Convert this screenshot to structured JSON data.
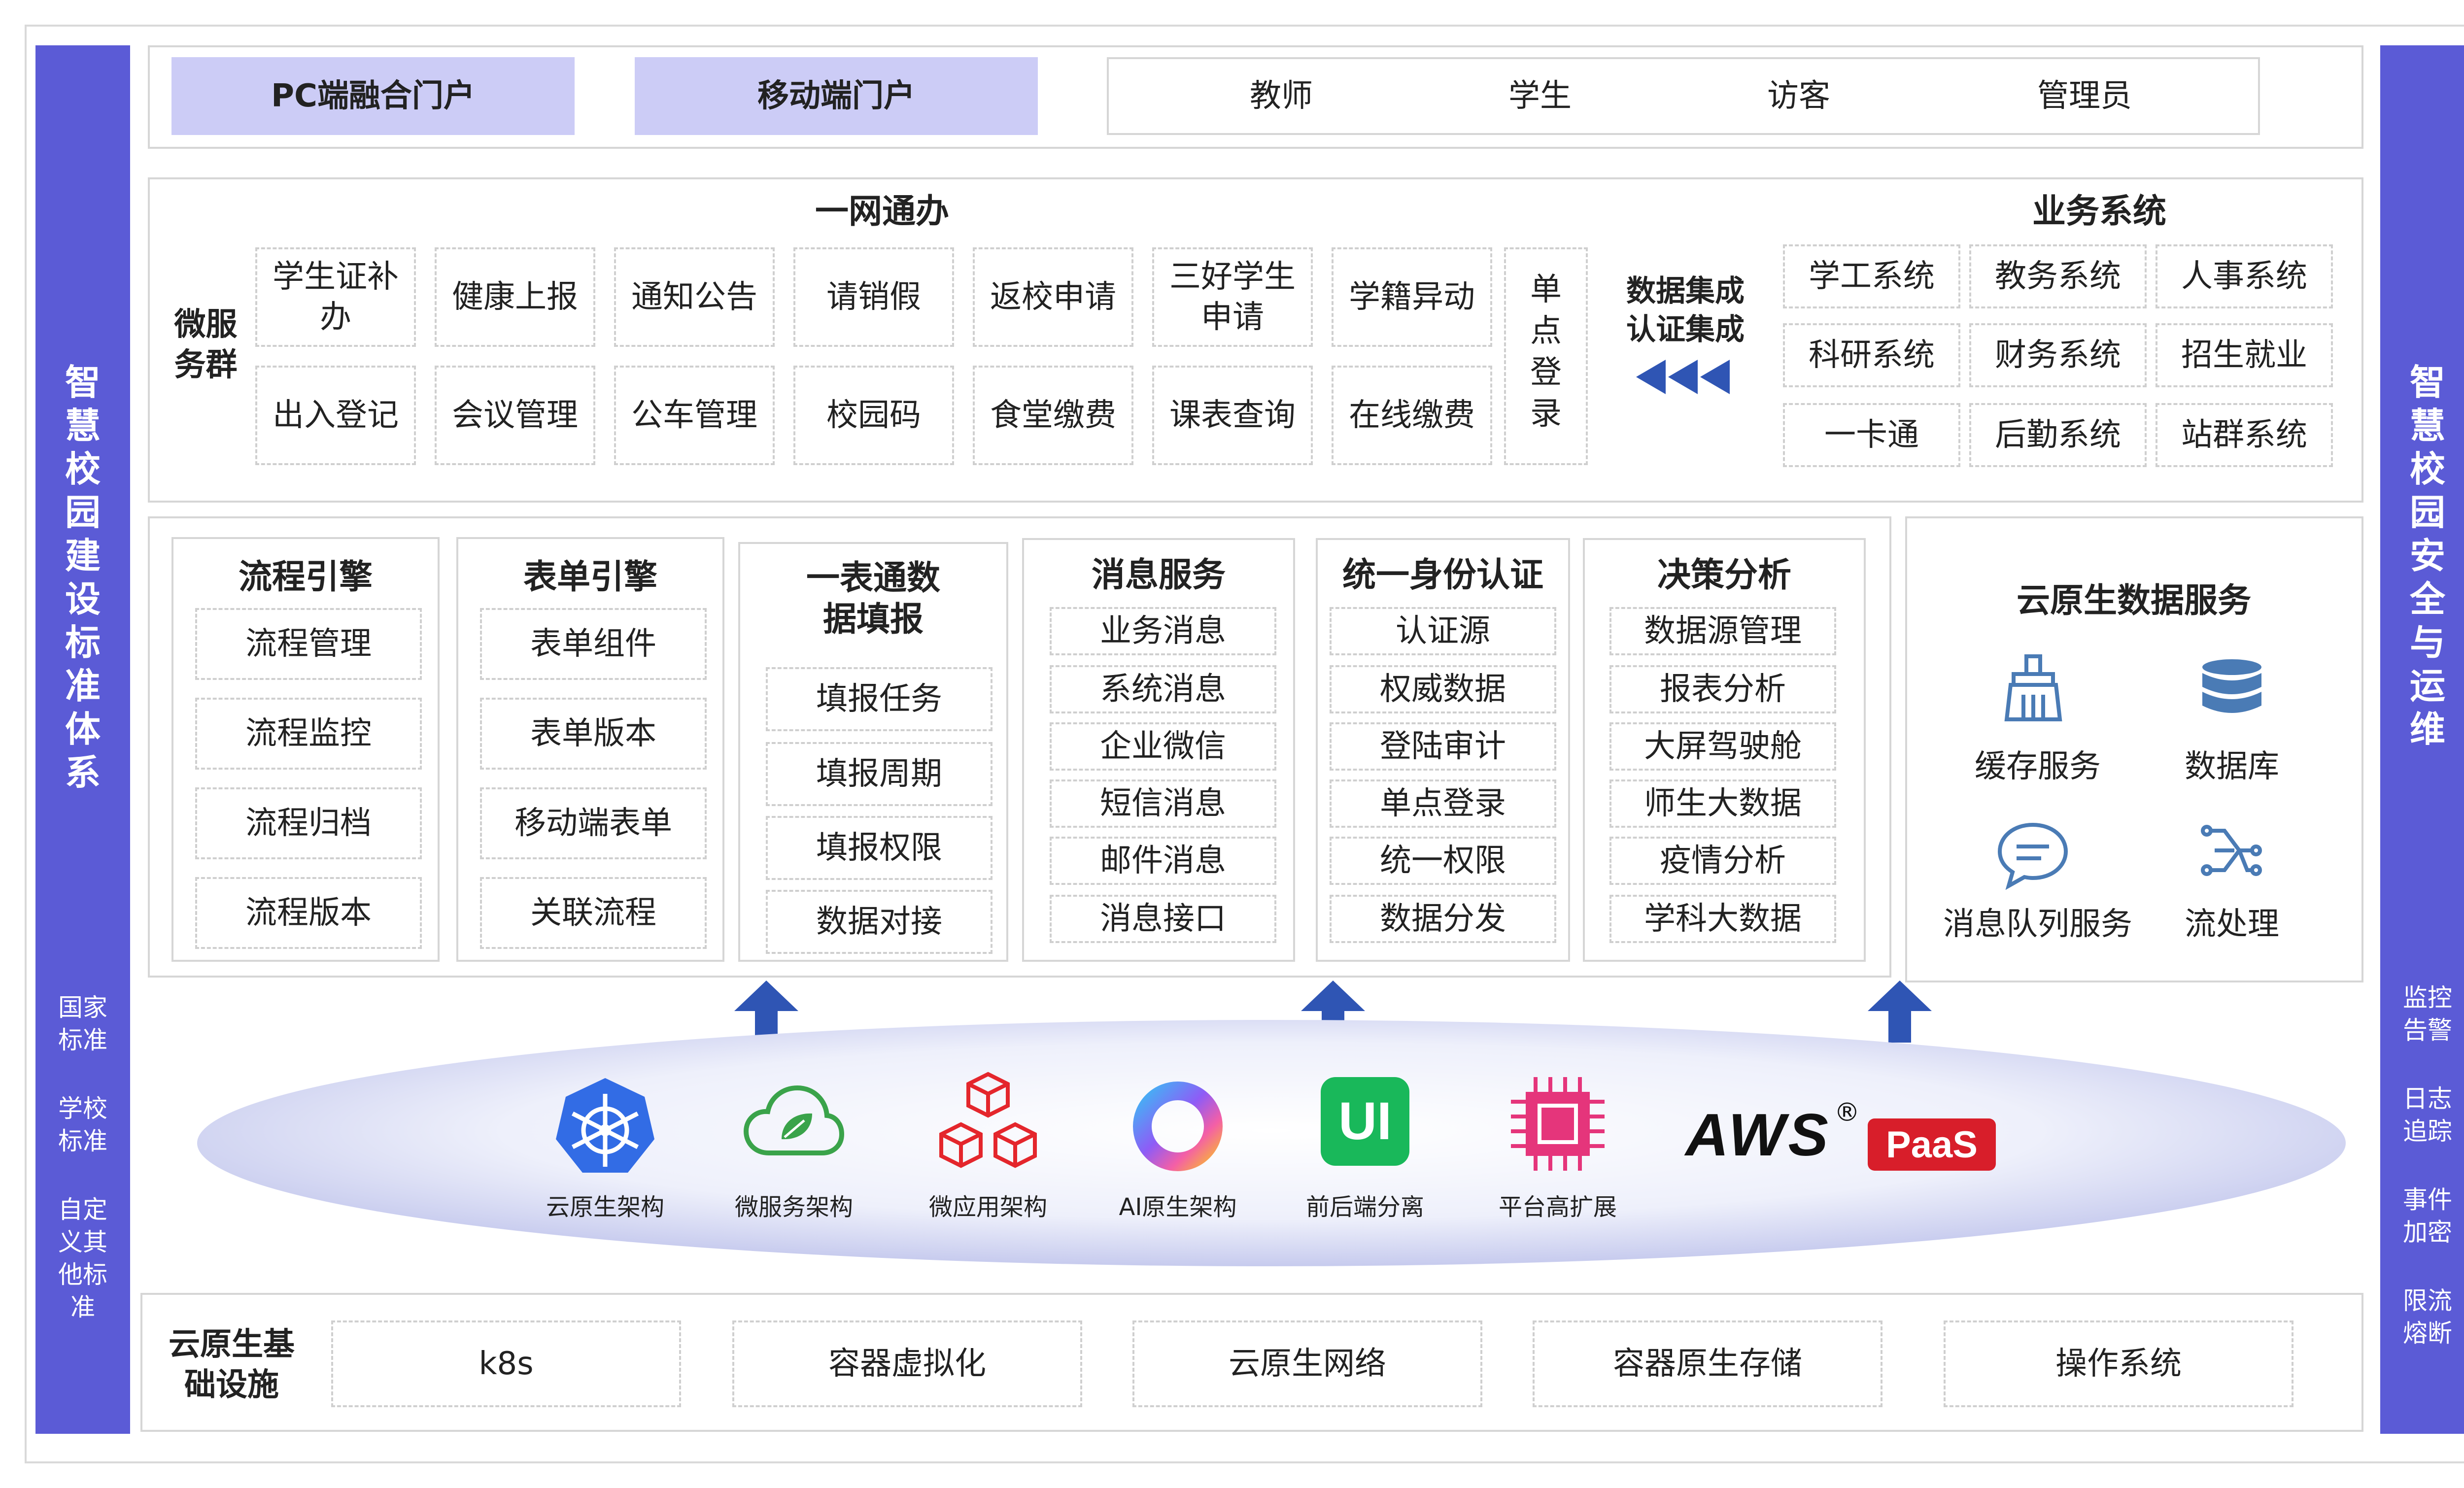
{
  "left_sidebar": {
    "title_chars": [
      "智",
      "慧",
      "校",
      "园",
      "建",
      "设",
      "标",
      "准",
      "体",
      "系"
    ],
    "items": [
      "国家标准",
      "学校标准",
      "自定义其他标准"
    ]
  },
  "right_sidebar": {
    "title_chars": [
      "智",
      "慧",
      "校",
      "园",
      "安",
      "全",
      "与",
      "运",
      "维"
    ],
    "items": [
      "监控告警",
      "日志追踪",
      "事件加密",
      "限流熔断"
    ]
  },
  "portal": {
    "pc": "PC端融合门户",
    "mobile": "移动端门户",
    "roles": [
      "教师",
      "学生",
      "访客",
      "管理员"
    ]
  },
  "services": {
    "title": "一网通办",
    "group_label": "微服务群",
    "row1": [
      "学生证补办",
      "健康上报",
      "通知公告",
      "请销假",
      "返校申请",
      "三好学生申请",
      "学籍异动"
    ],
    "row2": [
      "出入登记",
      "会议管理",
      "公车管理",
      "校园码",
      "食堂缴费",
      "课表查询",
      "在线缴费"
    ],
    "sso": [
      "单",
      "点",
      "登",
      "录"
    ],
    "integration": "数据集成认证集成",
    "biz_title": "业务系统",
    "biz": [
      "学工系统",
      "教务系统",
      "人事系统",
      "科研系统",
      "财务系统",
      "招生就业",
      "一卡通",
      "后勤系统",
      "站群系统"
    ]
  },
  "engines": [
    {
      "title": "流程引擎",
      "items": [
        "流程管理",
        "流程监控",
        "流程归档",
        "流程版本"
      ]
    },
    {
      "title": "表单引擎",
      "items": [
        "表单组件",
        "表单版本",
        "移动端表单",
        "关联流程"
      ]
    },
    {
      "title": "一表通数据填报",
      "items": [
        "填报任务",
        "填报周期",
        "填报权限",
        "数据对接"
      ]
    },
    {
      "title": "消息服务",
      "items": [
        "业务消息",
        "系统消息",
        "企业微信",
        "短信消息",
        "邮件消息",
        "消息接口"
      ]
    },
    {
      "title": "统一身份认证",
      "items": [
        "认证源",
        "权威数据",
        "登陆审计",
        "单点登录",
        "统一权限",
        "数据分发"
      ]
    },
    {
      "title": "决策分析",
      "items": [
        "数据源管理",
        "报表分析",
        "大屏驾驶舱",
        "师生大数据",
        "疫情分析",
        "学科大数据"
      ]
    }
  ],
  "cloud_data": {
    "title": "云原生数据服务",
    "items": [
      {
        "label": "缓存服务",
        "icon": "broom-icon"
      },
      {
        "label": "数据库",
        "icon": "database-icon"
      },
      {
        "label": "消息队列服务",
        "icon": "chat-bubble-icon"
      },
      {
        "label": "流处理",
        "icon": "stream-icon"
      }
    ]
  },
  "tech": [
    {
      "label": "云原生架构",
      "icon": "kubernetes-icon"
    },
    {
      "label": "微服务架构",
      "icon": "cloud-leaf-icon"
    },
    {
      "label": "微应用架构",
      "icon": "cubes-icon"
    },
    {
      "label": "AI原生架构",
      "icon": "ai-ring-icon"
    },
    {
      "label": "前后端分离",
      "icon": "ui-icon"
    },
    {
      "label": "平台高扩展",
      "icon": "chip-icon"
    }
  ],
  "aws": {
    "text": "AWS",
    "reg": "®",
    "paas": "PaaS"
  },
  "infra": {
    "label": "云原生基础设施",
    "items": [
      "k8s",
      "容器虚拟化",
      "云原生网络",
      "容器原生存储",
      "操作系统"
    ]
  },
  "colors": {
    "sidebar": "#5b5bd6",
    "portal_tab": "#ccccf6",
    "arrow": "#2f55b4",
    "border": "#d6d6d6"
  }
}
